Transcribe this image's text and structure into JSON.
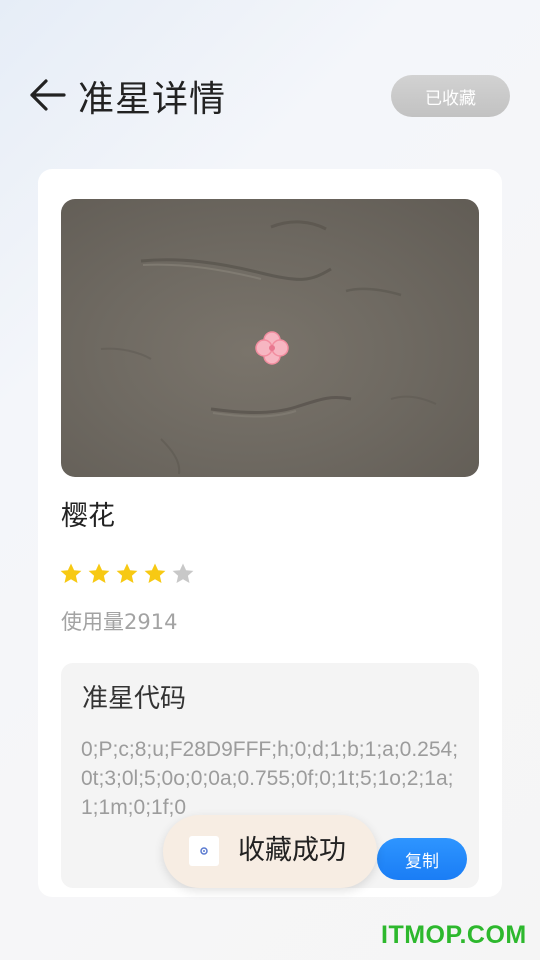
{
  "header": {
    "title": "准星详情",
    "collected_label": "已收藏",
    "back_icon": "arrow-left-icon"
  },
  "crosshair": {
    "name": "樱花",
    "rating": 4,
    "rating_max": 5,
    "usage_label": "使用量",
    "usage_count": "2914",
    "star_color": "#f7c913",
    "star_empty_color": "#c8c8c8"
  },
  "code_section": {
    "title": "准星代码",
    "code": "0;P;c;8;u;F28D9FFF;h;0;d;1;b;1;a;0.254;0t;3;0l;5;0o;0;0a;0.755;0f;0;1t;5;1o;2;1a;1;1m;0;1f;0",
    "copy_label": "复制"
  },
  "toast": {
    "text": "收藏成功"
  },
  "watermark": {
    "text": "ITMOP.COM"
  },
  "colors": {
    "accent": "#1a7df5",
    "crosshair_pink": "#f28d9f"
  }
}
